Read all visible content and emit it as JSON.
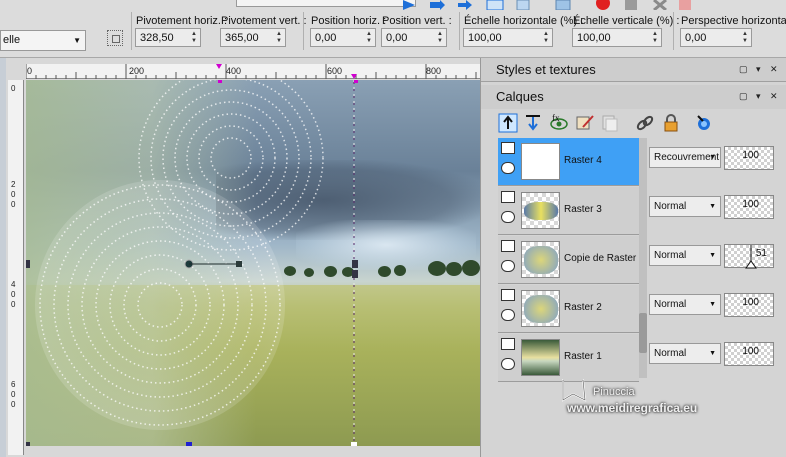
{
  "toolbar": {
    "combo_left": "elle",
    "fields": [
      {
        "label": "Pivotement horiz. :",
        "value": "328,50"
      },
      {
        "label": "Pivotement vert. :",
        "value": "365,00"
      },
      {
        "label": "Position horiz. :",
        "value": "0,00"
      },
      {
        "label": "Position vert. :",
        "value": "0,00"
      },
      {
        "label": "Échelle horizontale (%) :",
        "value": "100,00"
      },
      {
        "label": "Échelle verticale (%) :",
        "value": "100,00"
      },
      {
        "label": "Perspective horizontale :",
        "value": "0,00"
      }
    ]
  },
  "ruler": {
    "h_labels": [
      "0",
      "200",
      "400",
      "600",
      "800"
    ],
    "v_labels": [
      "0",
      "2",
      "0",
      "0",
      "4",
      "0",
      "0",
      "6",
      "0",
      "0"
    ]
  },
  "panels": {
    "styles_title": "Styles et textures",
    "layers_title": "Calques"
  },
  "layers": [
    {
      "name": "Raster 4",
      "blend": "Recouvrement",
      "opacity": "100",
      "selected": true
    },
    {
      "name": "Raster 3",
      "blend": "Normal",
      "opacity": "100",
      "selected": false
    },
    {
      "name": "Copie de Raster 2",
      "blend": "Normal",
      "opacity": "51",
      "selected": false
    },
    {
      "name": "Raster 2",
      "blend": "Normal",
      "opacity": "100",
      "selected": false
    },
    {
      "name": "Raster 1",
      "blend": "Normal",
      "opacity": "100",
      "selected": false
    }
  ],
  "watermark": {
    "line1": "Pinuccia",
    "line2": "www.meidiregrafica.eu"
  },
  "colors": {
    "selected_layer": "#3fa0f5",
    "accent_blue": "#1e6fd8",
    "panel_bg": "#d4d4d4"
  }
}
